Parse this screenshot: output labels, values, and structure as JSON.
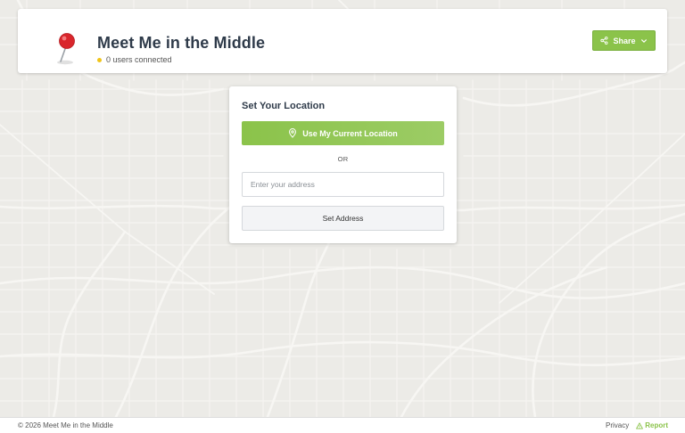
{
  "header": {
    "title": "Meet Me in the Middle",
    "status": "0 users connected",
    "status_color": "#f0c419",
    "pin_icon": "red-pushpin",
    "share_label": "Share",
    "share_icon": "share-icon",
    "share_caret": "chevron-down-icon"
  },
  "location_card": {
    "title": "Set Your Location",
    "current_location_label": "Use My Current Location",
    "current_location_icon": "map-pin-icon",
    "divider": "OR",
    "address_placeholder": "Enter your address",
    "address_value": "",
    "set_address_label": "Set Address"
  },
  "footer": {
    "copyright": "© 2026 Meet Me in the Middle",
    "privacy": "Privacy",
    "report": "Report",
    "report_icon": "warning-triangle-icon"
  },
  "colors": {
    "accent": "#8bc34a",
    "title_text": "#2f3b4a",
    "map_background": "#ecebe7",
    "map_roads": "#f7f6f3"
  }
}
